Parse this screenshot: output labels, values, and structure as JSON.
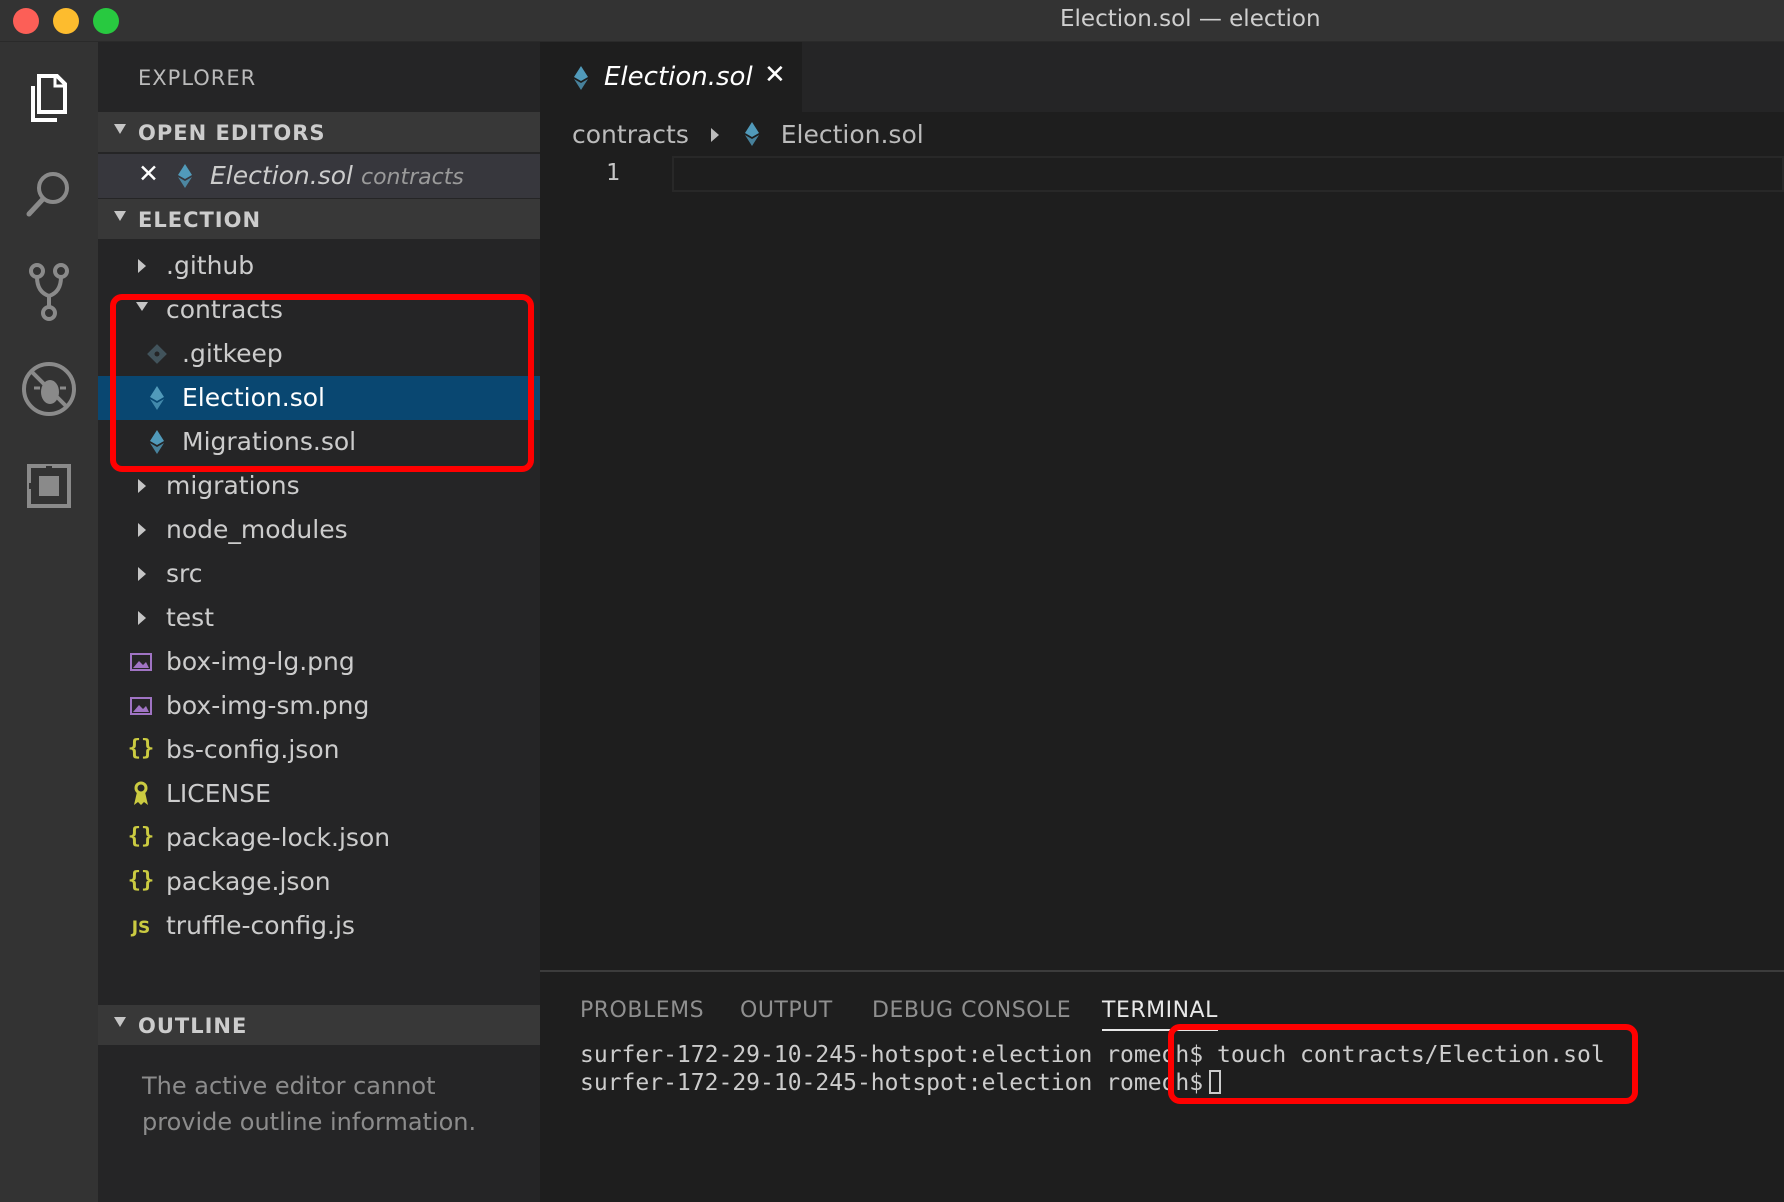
{
  "window": {
    "title": "Election.sol — election"
  },
  "activity_bar": {
    "items": [
      {
        "icon": "files-icon",
        "active": true
      },
      {
        "icon": "search-icon"
      },
      {
        "icon": "source-control-icon"
      },
      {
        "icon": "debug-icon"
      },
      {
        "icon": "extensions-icon"
      }
    ]
  },
  "sidebar": {
    "title": "EXPLORER",
    "open_editors": {
      "header": "OPEN EDITORS",
      "items": [
        {
          "name": "Election.sol",
          "folder": "contracts"
        }
      ]
    },
    "project": {
      "header": "ELECTION",
      "items": [
        {
          "name": ".github",
          "type": "folder",
          "expanded": false
        },
        {
          "name": "contracts",
          "type": "folder",
          "expanded": true
        },
        {
          "name": ".gitkeep",
          "type": "git"
        },
        {
          "name": "Election.sol",
          "type": "solidity",
          "selected": true
        },
        {
          "name": "Migrations.sol",
          "type": "solidity"
        },
        {
          "name": "migrations",
          "type": "folder",
          "expanded": false
        },
        {
          "name": "node_modules",
          "type": "folder",
          "expanded": false
        },
        {
          "name": "src",
          "type": "folder",
          "expanded": false
        },
        {
          "name": "test",
          "type": "folder",
          "expanded": false
        },
        {
          "name": "box-img-lg.png",
          "type": "image"
        },
        {
          "name": "box-img-sm.png",
          "type": "image"
        },
        {
          "name": "bs-config.json",
          "type": "json"
        },
        {
          "name": "LICENSE",
          "type": "license"
        },
        {
          "name": "package-lock.json",
          "type": "json"
        },
        {
          "name": "package.json",
          "type": "json"
        },
        {
          "name": "truffle-config.js",
          "type": "js"
        }
      ]
    },
    "outline": {
      "header": "OUTLINE",
      "message": "The active editor cannot provide outline information."
    }
  },
  "editor": {
    "tab": {
      "label": "Election.sol",
      "close_label": "✕"
    },
    "breadcrumb": {
      "folder": "contracts",
      "file": "Election.sol"
    },
    "line_number": "1"
  },
  "panel": {
    "tabs": [
      "PROBLEMS",
      "OUTPUT",
      "DEBUG CONSOLE",
      "TERMINAL"
    ],
    "active_tab": "TERMINAL",
    "terminal_lines": [
      "surfer-172-29-10-245-hotspot:election romeoh$ touch contracts/Election.sol",
      "surfer-172-29-10-245-hotspot:election romeoh$"
    ]
  },
  "colors": {
    "selection": "#094771",
    "solidity_icon": "#519aba",
    "json_icon": "#cbcb41",
    "image_icon": "#a074c4",
    "annotation": "#ff0000"
  }
}
